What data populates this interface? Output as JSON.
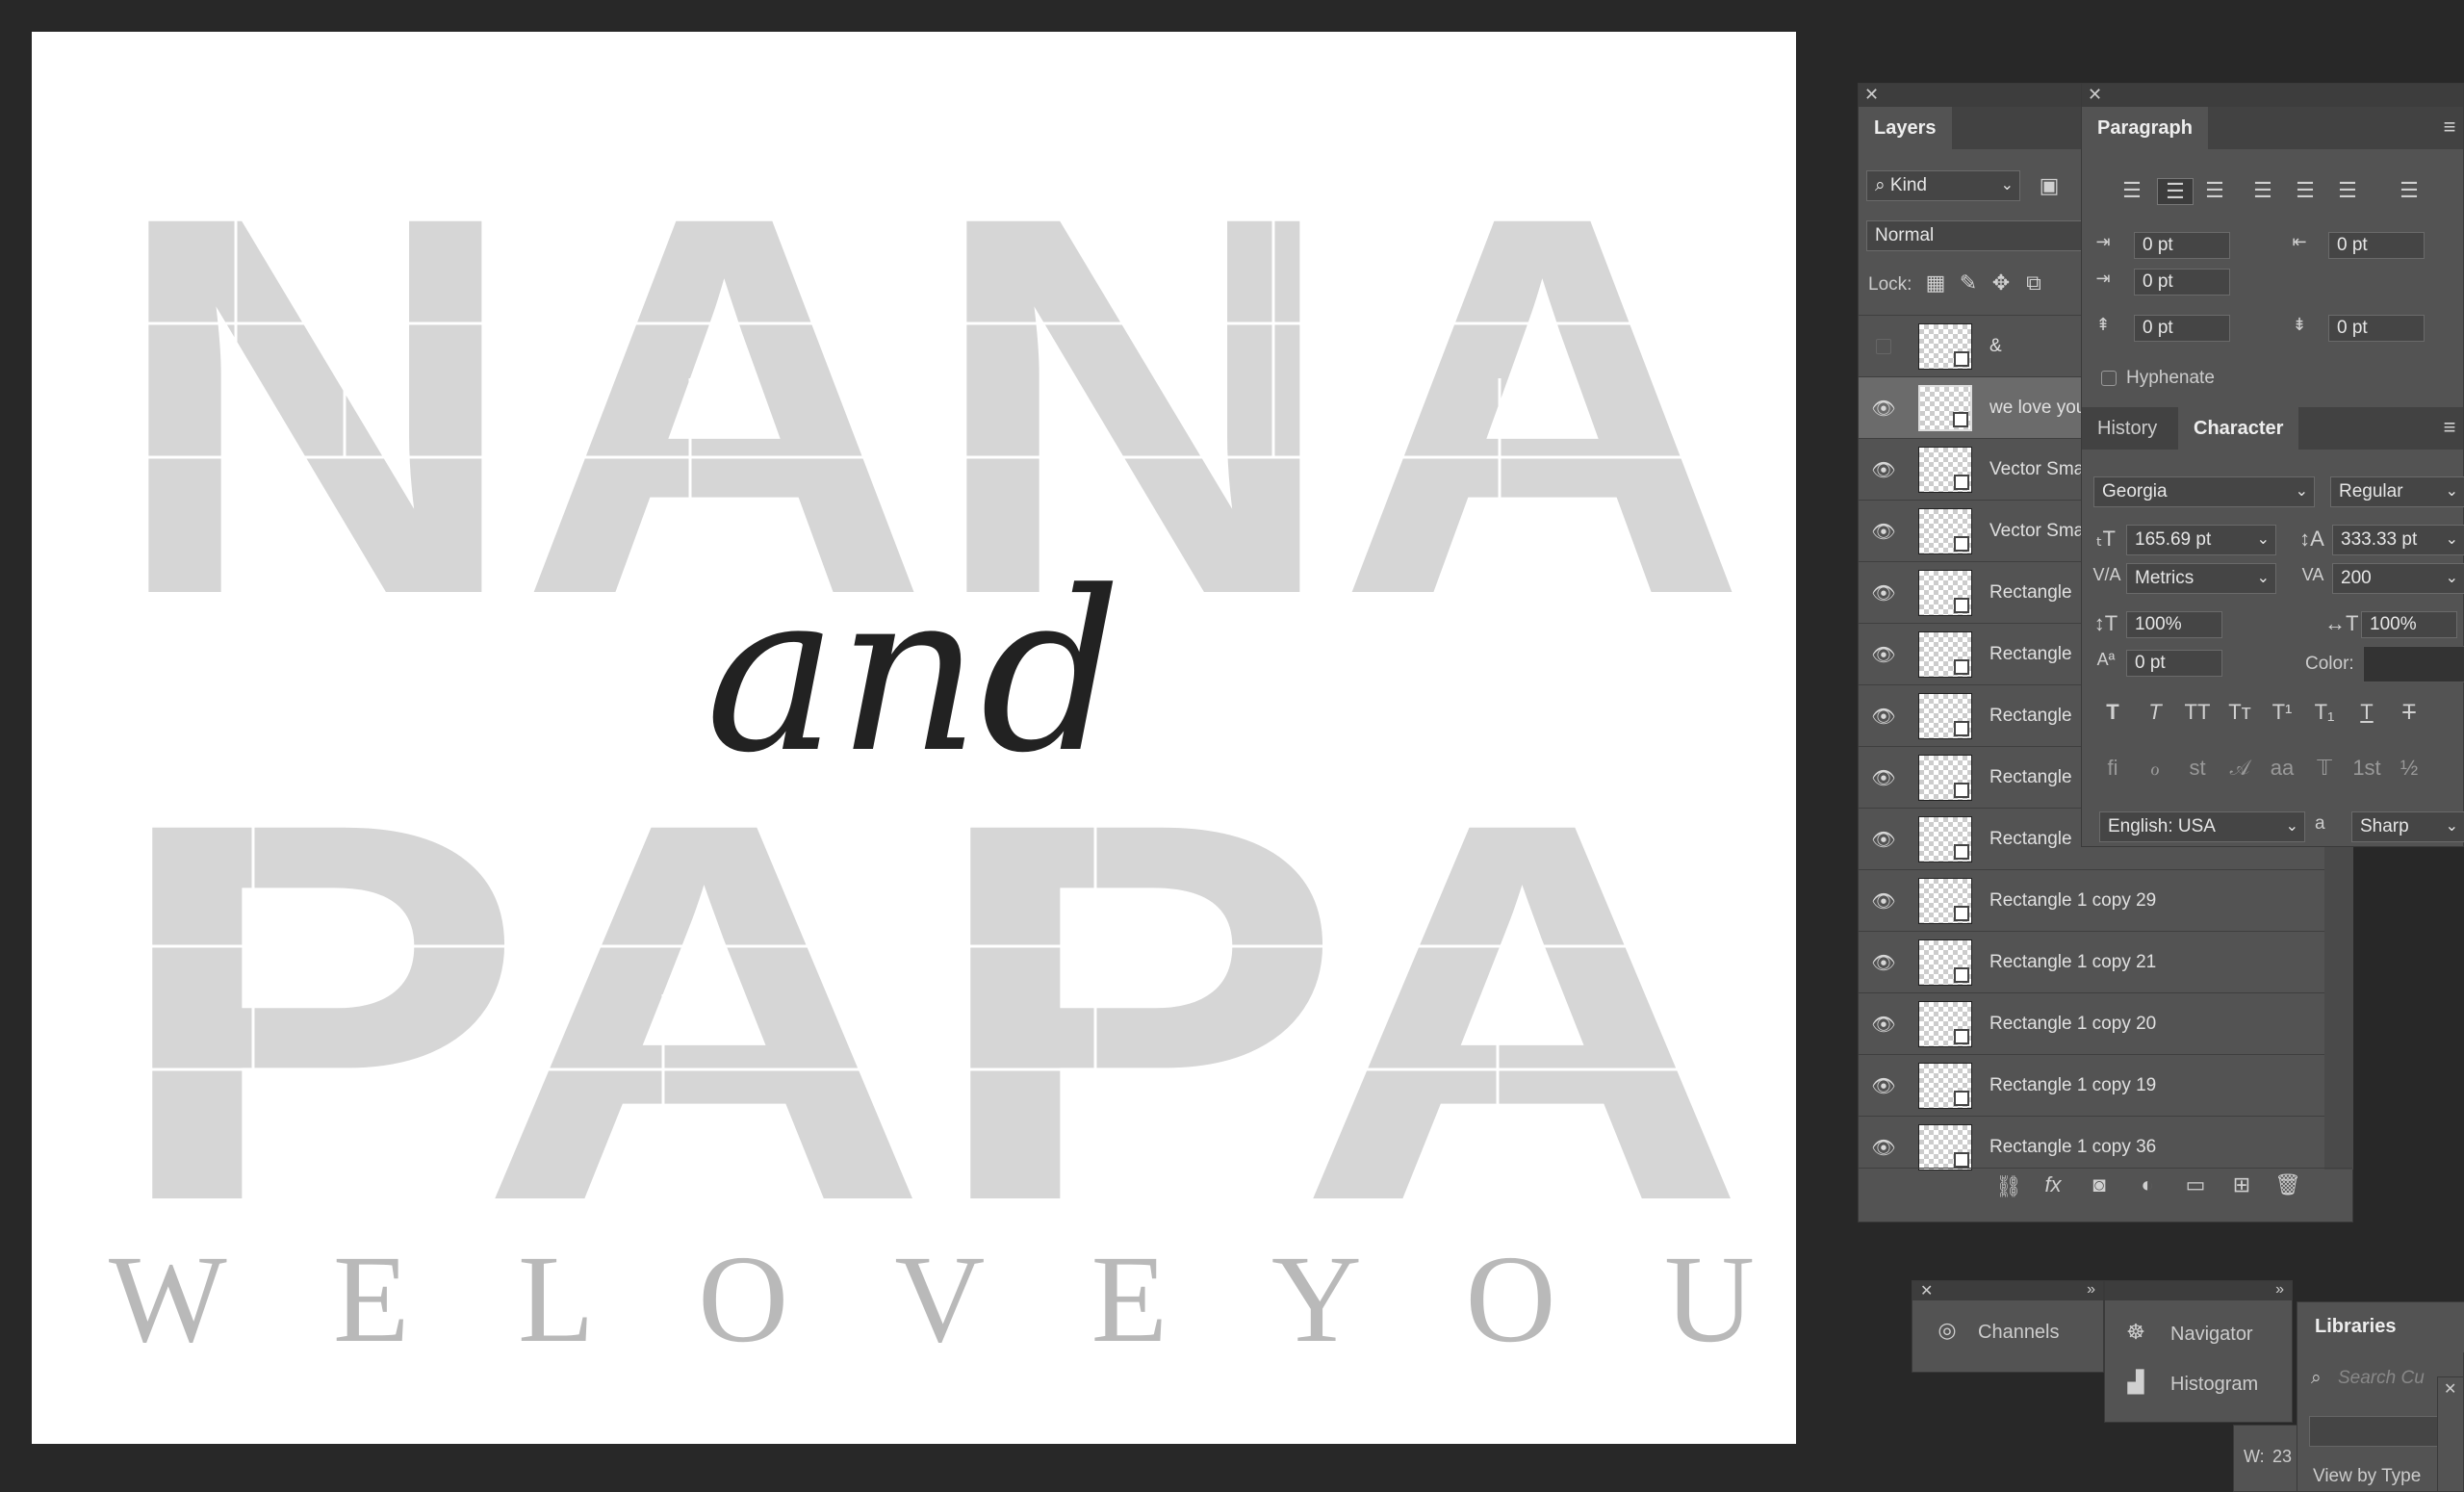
{
  "canvas": {
    "big_words": [
      "NANA",
      "PAPA"
    ],
    "script_word": "and",
    "tagline": "W E   L O V E   Y O U"
  },
  "layers_panel": {
    "title": "Layers",
    "filter_kind": "Kind",
    "blend_mode": "Normal",
    "lock_label": "Lock:",
    "layers": [
      {
        "name": "&",
        "visible": false
      },
      {
        "name": "we love you",
        "visible": true
      },
      {
        "name": "Vector Sma",
        "visible": true
      },
      {
        "name": "Vector Sma",
        "visible": true
      },
      {
        "name": "Rectangle",
        "visible": true
      },
      {
        "name": "Rectangle",
        "visible": true
      },
      {
        "name": "Rectangle",
        "visible": true
      },
      {
        "name": "Rectangle",
        "visible": true
      },
      {
        "name": "Rectangle",
        "visible": true
      },
      {
        "name": "Rectangle 1  copy 29",
        "visible": true
      },
      {
        "name": "Rectangle 1  copy 21",
        "visible": true
      },
      {
        "name": "Rectangle 1  copy 20",
        "visible": true
      },
      {
        "name": "Rectangle 1  copy 19",
        "visible": true
      },
      {
        "name": "Rectangle 1  copy 36",
        "visible": true
      }
    ]
  },
  "paragraph_panel": {
    "title": "Paragraph",
    "indent_left": "0 pt",
    "indent_right": "0 pt",
    "indent_first": "0 pt",
    "space_before": "0 pt",
    "space_after": "0 pt",
    "hyphenate_label": "Hyphenate"
  },
  "character_panel": {
    "tab_history": "History",
    "tab_character": "Character",
    "font_family": "Georgia",
    "font_style": "Regular",
    "font_size": "165.69 pt",
    "leading": "333.33 pt",
    "kerning": "Metrics",
    "tracking": "200",
    "vertical_scale": "100%",
    "horizontal_scale": "100%",
    "baseline_shift": "0 pt",
    "color_label": "Color:",
    "language": "English: USA",
    "antialias": "Sharp",
    "aa_glyph": "a",
    "style_buttons": [
      "T",
      "T",
      "TT",
      "Tт",
      "T¹",
      "T₁",
      "T",
      "T"
    ],
    "opentype_buttons": [
      "fi",
      "ℴ",
      "st",
      "𝒜",
      "aa",
      "𝕋",
      "1st",
      "½"
    ]
  },
  "dock": {
    "channels": "Channels",
    "navigator": "Navigator",
    "histogram": "Histogram",
    "libraries": "Libraries",
    "search_placeholder": "Search Cu",
    "view_by_type": "View by Type",
    "w_label": "W:",
    "w_value": "23"
  }
}
